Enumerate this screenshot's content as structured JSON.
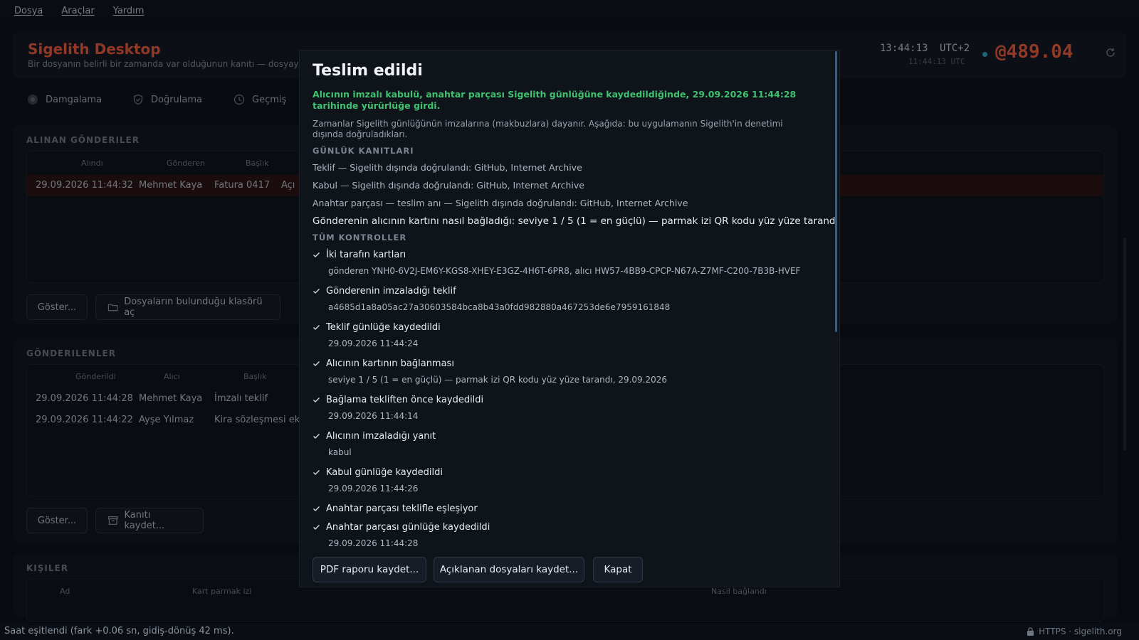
{
  "menu": {
    "items": [
      "Dosya",
      "Araçlar",
      "Yardım"
    ]
  },
  "header": {
    "title": "Sigelith Desktop",
    "subtitle": "Bir dosyanın belirli bir zamanda var olduğunun kanıtı — dosyayı gör",
    "clock_local": "13:44:13",
    "clock_tz": "UTC+2",
    "clock_utc": "11:44:13 UTC",
    "balance": "@489.04",
    "accent_color": "#e0563b"
  },
  "tabs": [
    {
      "label": "Damgalama",
      "icon": "stamp-icon"
    },
    {
      "label": "Doğrulama",
      "icon": "shield-icon"
    },
    {
      "label": "Geçmiş",
      "icon": "clock-icon"
    }
  ],
  "received": {
    "title": "ALINAN GÖNDERILER",
    "columns": [
      "Alındı",
      "Gönderen",
      "Başlık"
    ],
    "rows": [
      {
        "date": "29.09.2026 11:44:32",
        "sender": "Mehmet Kaya",
        "subject": "Fatura 0417",
        "extra": "Açı"
      }
    ],
    "show_button": "Göster...",
    "folder_button": "Dosyaların bulunduğu klasörü aç"
  },
  "sent": {
    "title": "GÖNDERILENLER",
    "columns": [
      "Gönderildi",
      "Alıcı",
      "Başlık"
    ],
    "rows": [
      {
        "date": "29.09.2026 11:44:28",
        "recipient": "Mehmet Kaya",
        "subject": "İmzalı teklif"
      },
      {
        "date": "29.09.2026 11:44:22",
        "recipient": "Ayşe Yılmaz",
        "subject": "Kira sözleşmesi ek"
      }
    ],
    "show_button": "Göster...",
    "save_button": "Kanıtı kaydet..."
  },
  "contacts": {
    "title": "KIŞILER",
    "columns": [
      "Ad",
      "Kart parmak izi",
      "Nasıl bağlandı"
    ]
  },
  "status_bar": {
    "text": "Saat eşitlendi (fark +0.06 sn, gidiş-dönüş 42 ms).",
    "right": "HTTPS · sigelith.org"
  },
  "dialog": {
    "title": "Teslim edildi",
    "highlight": "Alıcının imzalı kabulü, anahtar parçası Sigelith günlüğüne kaydedildiğinde, 29.09.2026 11:44:28 tarihinde yürürlüğe girdi.",
    "note": "Zamanlar Sigelith günlüğünün imzalarına (makbuzlara) dayanır. Aşağıda: bu uygulamanın Sigelith'in denetimi dışında doğruladıkları.",
    "log_proofs_title": "GÜNLÜK KANITLARI",
    "log_proofs": [
      "Teklif — Sigelith dışında doğrulandı: GitHub, Internet Archive",
      "Kabul — Sigelith dışında doğrulandı: GitHub, Internet Archive",
      "Anahtar parçası — teslim anı — Sigelith dışında doğrulandı: GitHub, Internet Archive"
    ],
    "binding_line": "Gönderenin alıcının kartını nasıl bağladığı: seviye 1 / 5 (1 = en güçlü) — parmak izi QR kodu yüz yüze tarandı",
    "checks_title": "TÜM KONTROLLER",
    "checks": [
      {
        "label": "İki tarafın kartları",
        "detail": "gönderen YNH0-6V2J-EM6Y-KGS8-XHEY-E3GZ-4H6T-6PR8, alıcı HW57-4BB9-CPCP-N67A-Z7MF-C200-7B3B-HVEF"
      },
      {
        "label": "Gönderenin imzaladığı teklif",
        "detail": "a4685d1a8a05ac27a30603584bca8b43a0fdd982880a467253de6e7959161848"
      },
      {
        "label": "Teklif günlüğe kaydedildi",
        "detail": "29.09.2026 11:44:24"
      },
      {
        "label": "Alıcının kartının bağlanması",
        "detail": "seviye 1 / 5 (1 = en güçlü) — parmak izi QR kodu yüz yüze tarandı, 29.09.2026"
      },
      {
        "label": "Bağlama tekliften önce kaydedildi",
        "detail": "29.09.2026 11:44:14"
      },
      {
        "label": "Alıcının imzaladığı yanıt",
        "detail": "kabul"
      },
      {
        "label": "Kabul günlüğe kaydedildi",
        "detail": "29.09.2026 11:44:26"
      },
      {
        "label": "Anahtar parçası teklifle eşleşiyor",
        "detail": ""
      },
      {
        "label": "Anahtar parçası günlüğe kaydedildi",
        "detail": "29.09.2026 11:44:28"
      }
    ],
    "buttons": {
      "pdf": "PDF raporu kaydet...",
      "files": "Açıklanan dosyaları kaydet...",
      "close": "Kapat"
    },
    "success_color": "#3fc270"
  }
}
